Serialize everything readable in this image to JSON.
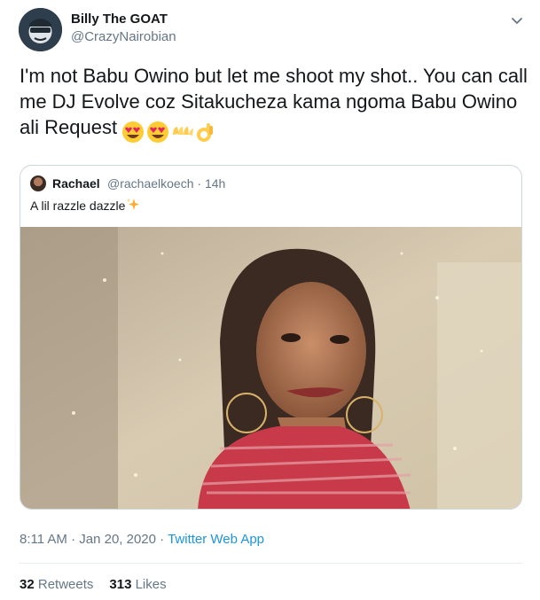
{
  "author": {
    "name": "Billy The GOAT",
    "handle": "@CrazyNairobian"
  },
  "tweet": {
    "text": "I'm not Babu Owino but let me shoot my shot.. You can call me DJ Evolve coz Sitakucheza kama ngoma Babu Owino ali Request",
    "emojis": [
      "heart-eyes-emoji",
      "heart-eyes-emoji",
      "open-hands-emoji",
      "ok-hand-emoji"
    ]
  },
  "quote": {
    "name": "Rachael",
    "handle": "@rachaelkoech",
    "sep": "·",
    "time": "14h",
    "text": "A lil razzle dazzle",
    "emoji": "sparkles-emoji"
  },
  "meta": {
    "timestamp": "8:11 AM · Jan 20, 2020",
    "sep": " · ",
    "source": "Twitter Web App"
  },
  "stats": {
    "retweets_count": "32",
    "retweets_label": "Retweets",
    "likes_count": "313",
    "likes_label": "Likes"
  },
  "colors": {
    "link": "#1b95e0",
    "secondary_text": "#657786",
    "border": "#ccd6dd"
  }
}
